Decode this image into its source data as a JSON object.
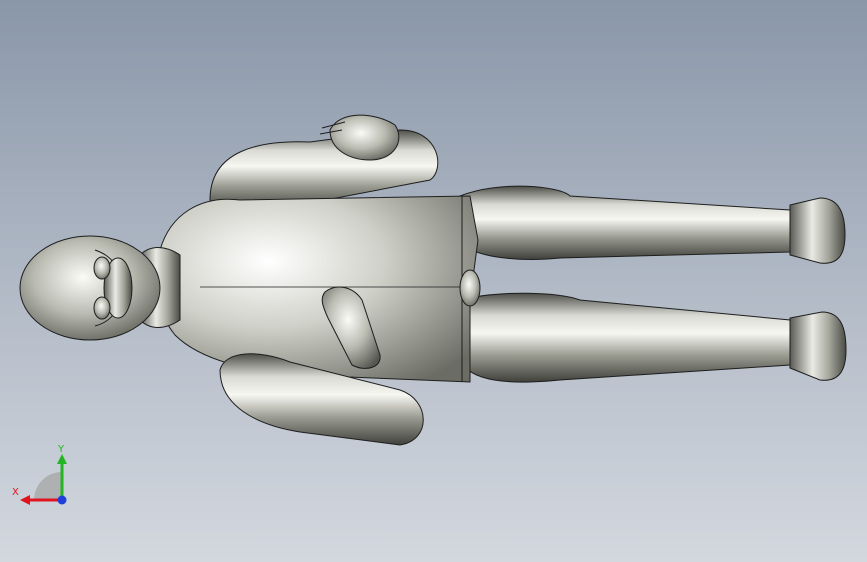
{
  "viewport": {
    "background_top": "#8a97a9",
    "background_bottom": "#d3d8df"
  },
  "model": {
    "material_color": "#a9aba0",
    "edge_color": "#1e1e1e"
  },
  "triad": {
    "x_label": "X",
    "y_label": "Y",
    "x_color": "#e0141e",
    "y_color": "#23b523",
    "z_color": "#1f3fd8"
  }
}
